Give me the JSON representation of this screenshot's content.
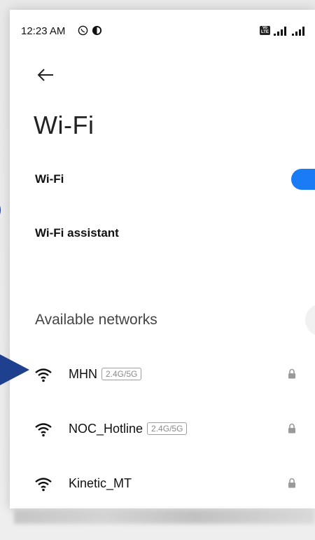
{
  "status_bar": {
    "time": "12:23 AM",
    "icons": [
      "whatsapp-icon",
      "app-notification-icon"
    ],
    "right_icons": [
      "volte-icon",
      "signal-icon-1",
      "signal-icon-2"
    ],
    "volte_label": "Vo LTE"
  },
  "header": {
    "back_icon": "back-arrow-icon",
    "title": "Wi-Fi"
  },
  "settings": {
    "wifi_label": "Wi-Fi",
    "wifi_enabled": true,
    "assistant_label": "Wi-Fi assistant"
  },
  "networks_section": {
    "header": "Available networks",
    "networks": [
      {
        "name": "MHN",
        "band": "2.4G/5G",
        "secured": true
      },
      {
        "name": "NOC_Hotline",
        "band": "2.4G/5G",
        "secured": true
      },
      {
        "name": "Kinetic_MT",
        "band": "",
        "secured": true
      }
    ]
  },
  "colors": {
    "accent": "#1a7cf5",
    "annotation": "#1f3f8f",
    "text_primary": "#111111",
    "text_secondary": "#444444"
  }
}
